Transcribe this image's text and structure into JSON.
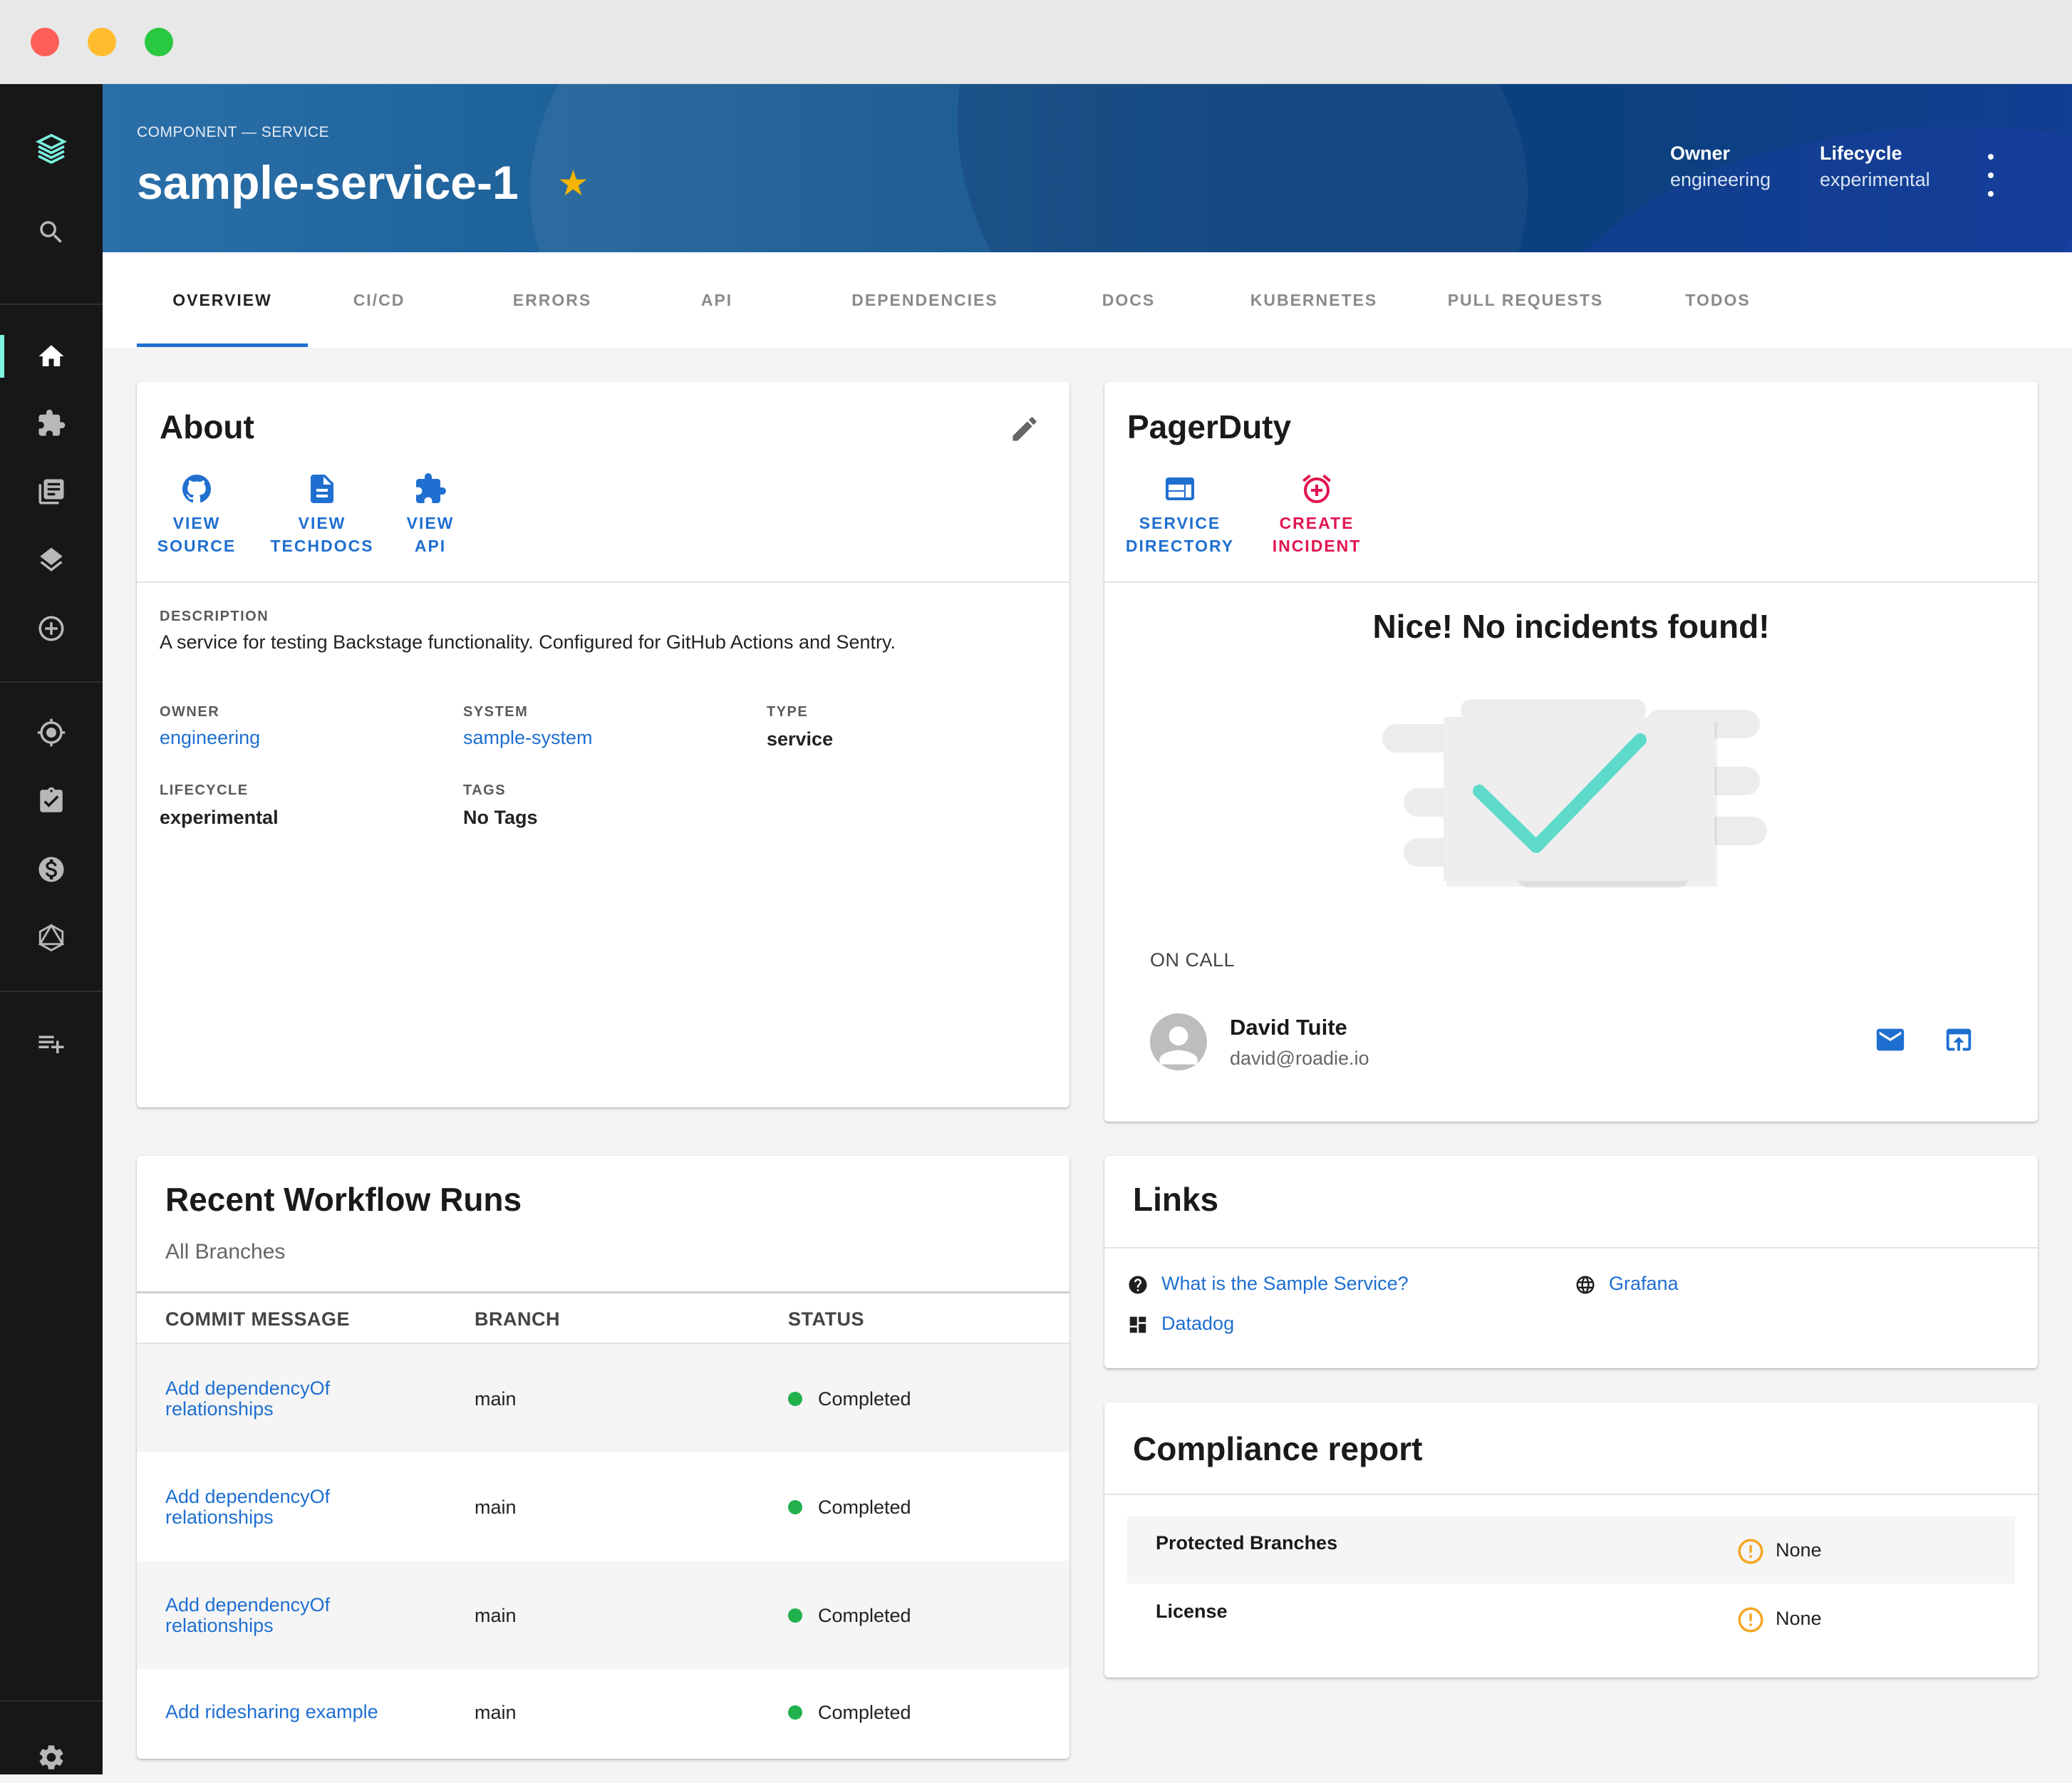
{
  "header": {
    "breadcrumb": "COMPONENT — SERVICE",
    "title": "sample-service-1",
    "owner_label": "Owner",
    "owner_value": "engineering",
    "lifecycle_label": "Lifecycle",
    "lifecycle_value": "experimental"
  },
  "tabs": [
    "OVERVIEW",
    "CI/CD",
    "ERRORS",
    "API",
    "DEPENDENCIES",
    "DOCS",
    "KUBERNETES",
    "PULL REQUESTS",
    "TODOS"
  ],
  "about": {
    "title": "About",
    "actions": [
      {
        "line1": "VIEW",
        "line2": "SOURCE",
        "icon": "github-icon"
      },
      {
        "line1": "VIEW",
        "line2": "TECHDOCS",
        "icon": "document-icon"
      },
      {
        "line1": "VIEW",
        "line2": "API",
        "icon": "puzzle-icon"
      }
    ],
    "description_label": "DESCRIPTION",
    "description": "A service for testing Backstage functionality. Configured for GitHub Actions and Sentry.",
    "owner_label": "OWNER",
    "owner": "engineering",
    "system_label": "SYSTEM",
    "system": "sample-system",
    "type_label": "TYPE",
    "type": "service",
    "lifecycle_label": "LIFECYCLE",
    "lifecycle": "experimental",
    "tags_label": "TAGS",
    "tags": "No Tags"
  },
  "pagerduty": {
    "title": "PagerDuty",
    "actions": [
      {
        "line1": "SERVICE",
        "line2": "DIRECTORY",
        "icon": "web-icon"
      },
      {
        "line1": "CREATE",
        "line2": "INCIDENT",
        "icon": "alarm-add-icon"
      }
    ],
    "empty_message": "Nice! No incidents found!",
    "on_call_label": "ON CALL",
    "on_call_name": "David Tuite",
    "on_call_email": "david@roadie.io"
  },
  "workflows": {
    "title": "Recent Workflow Runs",
    "subtitle": "All Branches",
    "columns": [
      "COMMIT MESSAGE",
      "BRANCH",
      "STATUS"
    ],
    "rows": [
      {
        "message": "Add dependencyOf relationships",
        "branch": "main",
        "status": "Completed"
      },
      {
        "message": "Add dependencyOf relationships",
        "branch": "main",
        "status": "Completed"
      },
      {
        "message": "Add dependencyOf relationships",
        "branch": "main",
        "status": "Completed"
      },
      {
        "message": "Add ridesharing example",
        "branch": "main",
        "status": "Completed"
      }
    ]
  },
  "links": {
    "title": "Links",
    "items": [
      {
        "label": "What is the Sample Service?",
        "icon": "help-icon"
      },
      {
        "label": "Grafana",
        "icon": "globe-icon"
      },
      {
        "label": "Datadog",
        "icon": "dashboard-icon"
      }
    ]
  },
  "compliance": {
    "title": "Compliance report",
    "rows": [
      {
        "label": "Protected Branches",
        "value": "None"
      },
      {
        "label": "License",
        "value": "None"
      }
    ]
  },
  "colors": {
    "accent": "#1f6fd0",
    "sidebar": "#171717",
    "active_indicator": "#7df3e1",
    "status_success": "#23b14d",
    "warning": "#f5a623",
    "pagerduty_red": "#e1154f",
    "star": "#f4b400"
  }
}
